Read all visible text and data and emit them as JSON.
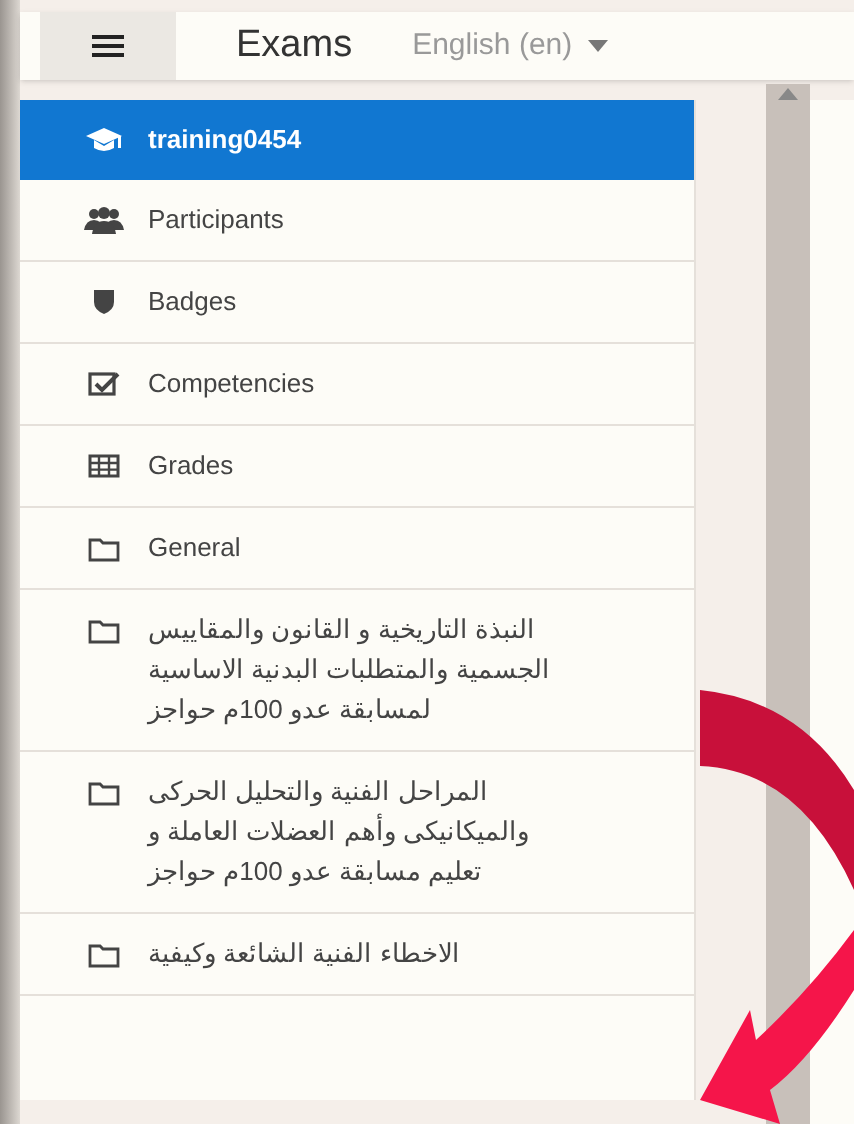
{
  "header": {
    "title": "Exams",
    "language": "English (en)"
  },
  "nav": [
    {
      "kind": "course",
      "label": "training0454",
      "selected": true
    },
    {
      "kind": "participants",
      "label": "Participants",
      "selected": false
    },
    {
      "kind": "badges",
      "label": "Badges",
      "selected": false
    },
    {
      "kind": "competencies",
      "label": "Competencies",
      "selected": false
    },
    {
      "kind": "grades",
      "label": "Grades",
      "selected": false
    },
    {
      "kind": "folder",
      "label": "General",
      "selected": false
    },
    {
      "kind": "folder",
      "label": "النبذة التاريخية و القانون والمقاييس الجسمية والمتطلبات البدنية الاساسية لمسابقة عدو 100م حواجز",
      "selected": false
    },
    {
      "kind": "folder",
      "label": "المراحل الفنية والتحليل الحركى والميكانيكى وأهم العضلات العاملة و تعليم مسابقة عدو 100م حواجز",
      "selected": false
    },
    {
      "kind": "folder",
      "label": "الاخطاء الفنية الشائعة وكيفية",
      "selected": false
    }
  ]
}
